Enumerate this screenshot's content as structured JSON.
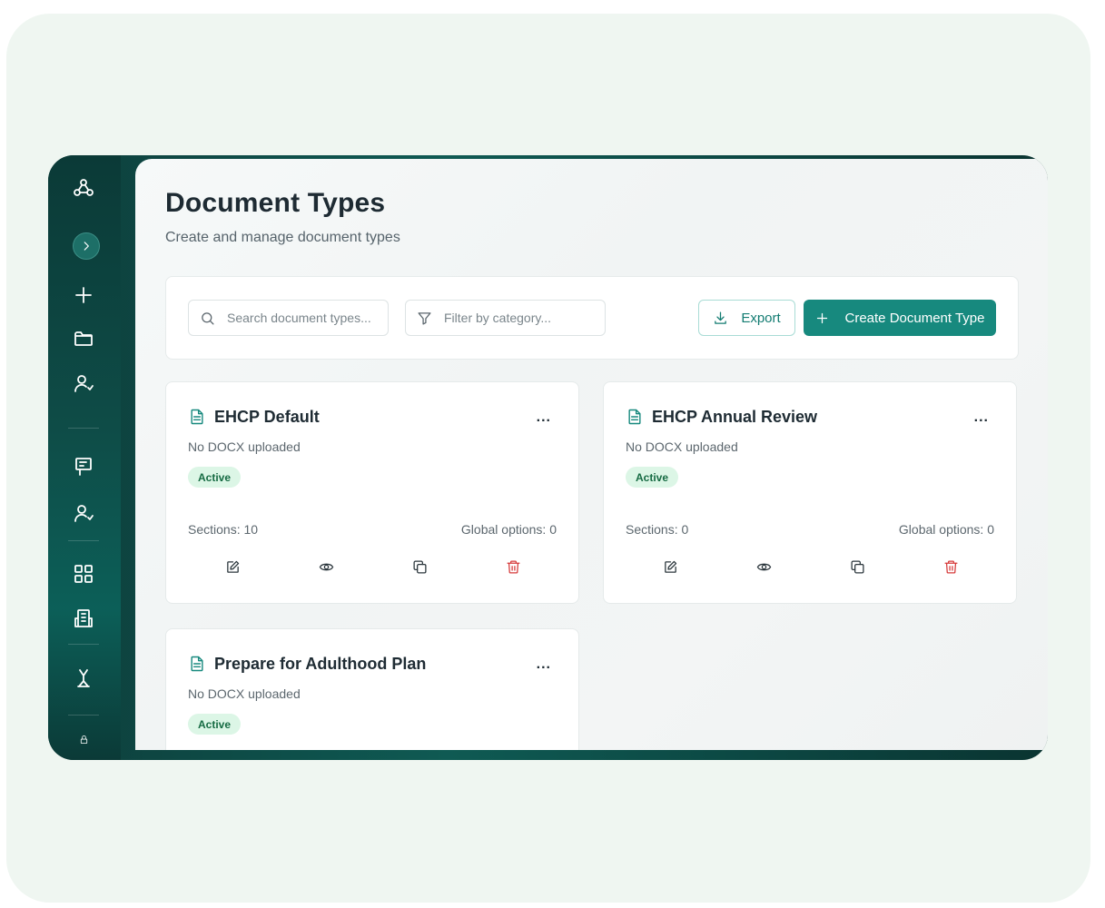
{
  "page": {
    "title": "Document Types",
    "subtitle": "Create and manage document types"
  },
  "sidebar": {
    "items": [
      {
        "icon": "network-logo-icon"
      },
      {
        "icon": "chevron-right-icon"
      },
      {
        "icon": "plus-icon"
      },
      {
        "icon": "folder-icon"
      },
      {
        "icon": "user-check-icon"
      },
      {
        "icon": "flag-board-icon"
      },
      {
        "icon": "user-check-icon"
      },
      {
        "icon": "grid-icon"
      },
      {
        "icon": "building-icon"
      },
      {
        "icon": "person-icon"
      },
      {
        "icon": "lock-icon"
      }
    ]
  },
  "toolbar": {
    "search_placeholder": "Search document types...",
    "filter_placeholder": "Filter by category...",
    "export_label": "Export",
    "create_label": "Create Document Type"
  },
  "cards": [
    {
      "title": "EHCP Default",
      "docx": "No DOCX uploaded",
      "status": "Active",
      "sections": "Sections: 10",
      "global_options": "Global options: 0",
      "menu": "..."
    },
    {
      "title": "EHCP Annual Review",
      "docx": "No DOCX uploaded",
      "status": "Active",
      "sections": "Sections: 0",
      "global_options": "Global options: 0",
      "menu": "..."
    },
    {
      "title": "Prepare for Adulthood Plan",
      "docx": "No DOCX uploaded",
      "status": "Active",
      "menu": "..."
    }
  ],
  "colors": {
    "primary": "#17897e",
    "badge_bg": "#dcf6e6",
    "badge_text": "#166b43",
    "danger": "#d63a3a",
    "sidebar": "#0e4c47"
  }
}
